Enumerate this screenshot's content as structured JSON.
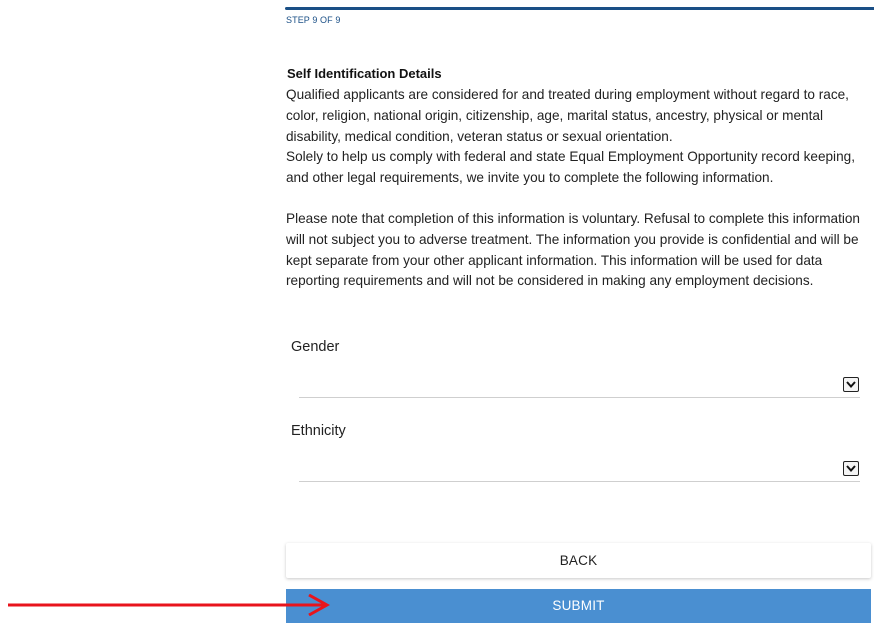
{
  "progress": {
    "step_label": "STEP 9 OF 9",
    "current_step": 9,
    "total_steps": 9,
    "color": "#1a4f86"
  },
  "section": {
    "title": "Self Identification Details",
    "paragraph1": "Qualified applicants are considered for and treated during employment without regard to race, color, religion, national origin, citizenship, age, marital status, ancestry, physical or mental disability, medical condition, veteran status or sexual orientation.",
    "paragraph2": "Solely to help us comply with federal and state Equal Employment Opportunity record keeping, and other legal requirements, we invite you to complete the following information.",
    "paragraph3": "Please note that completion of this information is voluntary. Refusal to complete this information will not subject you to adverse treatment. The information you provide is confidential and will be kept separate from your other applicant information. This information will be used for data reporting requirements and will not be considered in making any employment decisions."
  },
  "fields": {
    "gender": {
      "label": "Gender",
      "value": ""
    },
    "ethnicity": {
      "label": "Ethnicity",
      "value": ""
    }
  },
  "buttons": {
    "back_label": "BACK",
    "submit_label": "SUBMIT",
    "submit_color": "#4a8fd1"
  },
  "annotation": {
    "arrow_color": "#e8141c",
    "arrow_icon": "right-arrow-icon"
  }
}
